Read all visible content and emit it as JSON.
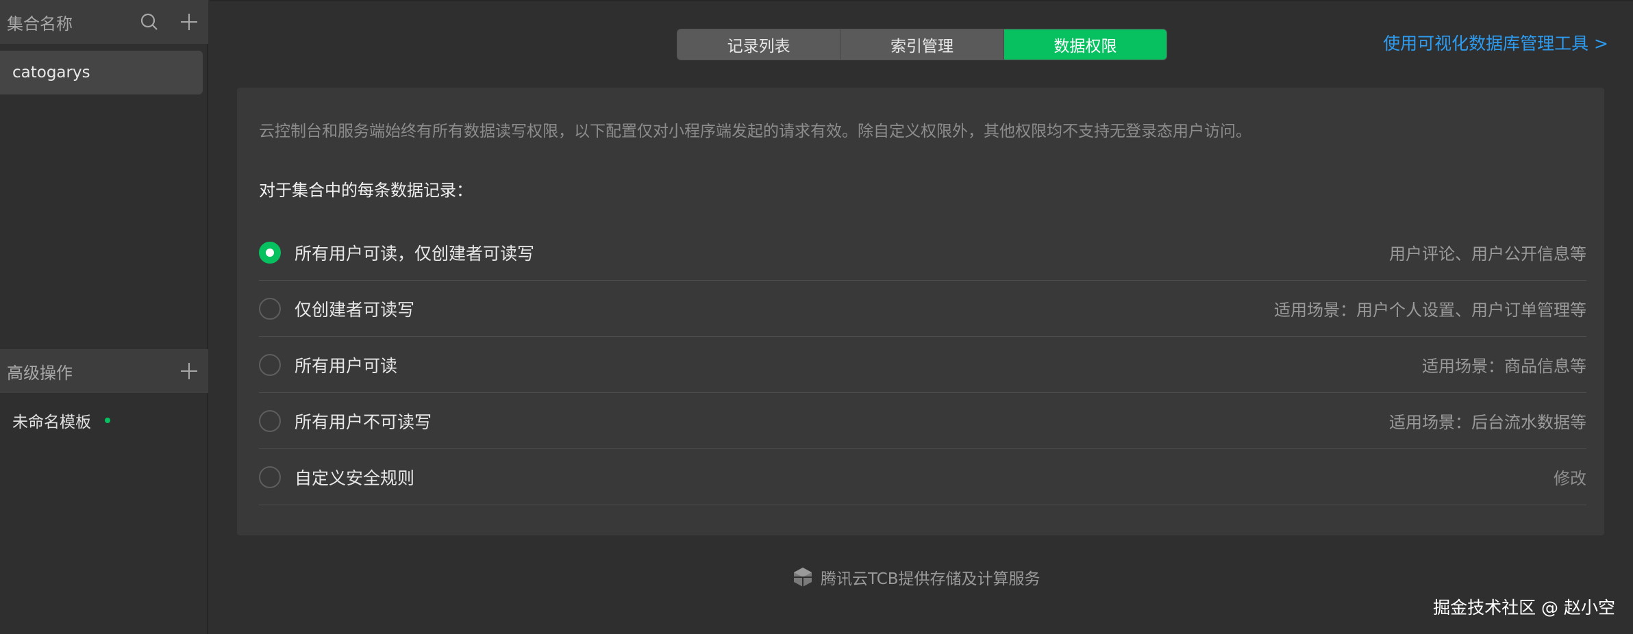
{
  "sidebar": {
    "collections_title": "集合名称",
    "collections": [
      "catogarys"
    ],
    "advanced_title": "高级操作",
    "templates": [
      "未命名模板"
    ]
  },
  "tabs": [
    {
      "label": "记录列表",
      "active": false
    },
    {
      "label": "索引管理",
      "active": false
    },
    {
      "label": "数据权限",
      "active": true
    }
  ],
  "tool_link": "使用可视化数据库管理工具 >",
  "panel": {
    "description": "云控制台和服务端始终有所有数据读写权限，以下配置仅对小程序端发起的请求有效。除自定义权限外，其他权限均不支持无登录态用户访问。",
    "subtitle": "对于集合中的每条数据记录：",
    "options": [
      {
        "label": "所有用户可读，仅创建者可读写",
        "hint": "用户评论、用户公开信息等",
        "checked": true
      },
      {
        "label": "仅创建者可读写",
        "hint": "适用场景：用户个人设置、用户订单管理等",
        "checked": false
      },
      {
        "label": "所有用户可读",
        "hint": "适用场景：商品信息等",
        "checked": false
      },
      {
        "label": "所有用户不可读写",
        "hint": "适用场景：后台流水数据等",
        "checked": false
      },
      {
        "label": "自定义安全规则",
        "hint": "修改",
        "checked": false
      }
    ]
  },
  "footer": "腾讯云TCB提供存储及计算服务",
  "watermark": "掘金技术社区 @ 赵小空",
  "colors": {
    "accent": "#07c160",
    "link": "#2d9cf0",
    "background": "#2f2f2f",
    "panel": "#393939"
  }
}
